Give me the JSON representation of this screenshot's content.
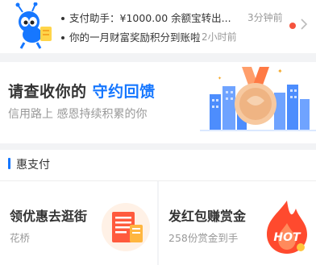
{
  "notifications": [
    {
      "text": "支付助手：¥1000.00 余额宝转出...",
      "time": "3分钟前"
    },
    {
      "text": "你的一月财富奖励积分到账啦",
      "time": "2小时前"
    }
  ],
  "banner": {
    "title_prefix": "请查收你的 ",
    "title_highlight": "守约回馈",
    "subtitle": "信用路上 感恩持续积累的你"
  },
  "section": {
    "title": "惠支付"
  },
  "cards": [
    {
      "title": "领优惠去逛街",
      "subtitle": "花桥",
      "icon": "receipt-icon"
    },
    {
      "title": "发红包赚赏金",
      "subtitle": "258份赏金到手",
      "icon": "hot-flame-icon",
      "icon_text": "HOT"
    }
  ],
  "colors": {
    "accent": "#1677ff",
    "badge": "#f5533d",
    "hot": "#ff4a2e"
  }
}
